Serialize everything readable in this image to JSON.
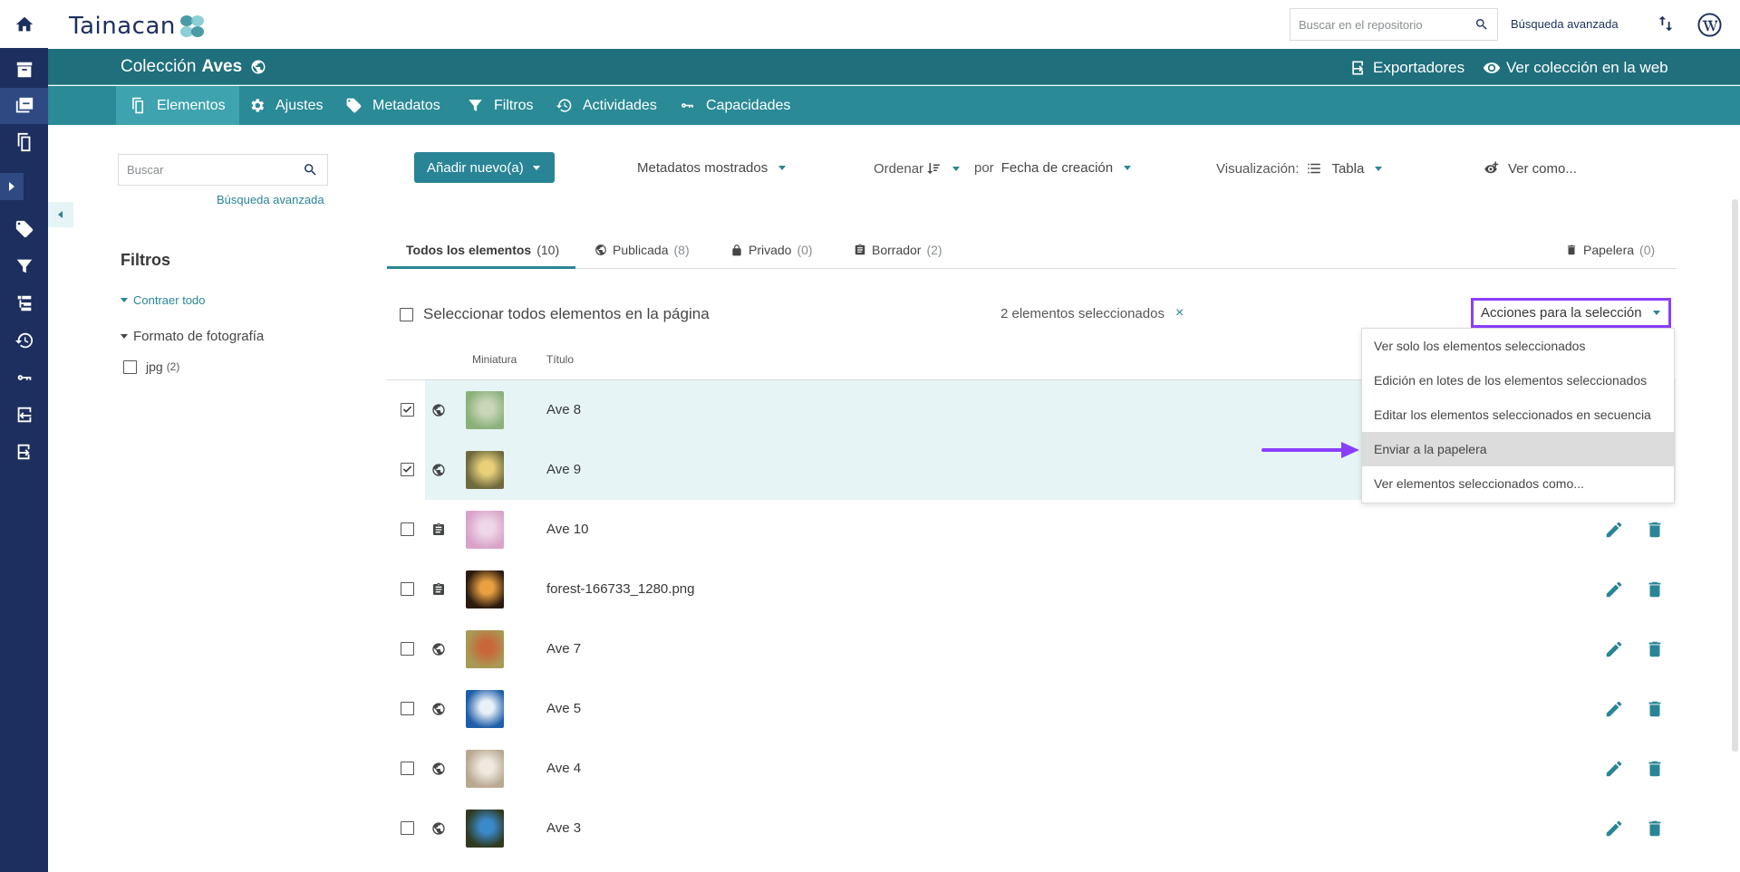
{
  "header": {
    "logo_text": "Tainacan",
    "search_placeholder": "Buscar en el repositorio",
    "advanced_search": "Búsqueda avanzada"
  },
  "collection": {
    "prefix": "Colección",
    "name": "Aves",
    "exporters": "Exportadores",
    "view_web": "Ver colección en la web"
  },
  "nav_tabs": {
    "items": "Elementos",
    "settings": "Ajustes",
    "metadata": "Metadatos",
    "filters": "Filtros",
    "activities": "Actividades",
    "capabilities": "Capacidades"
  },
  "sidebar": {
    "search_placeholder": "Buscar",
    "advanced_search": "Búsqueda avanzada",
    "filters_title": "Filtros",
    "collapse_all": "Contraer todo",
    "facet_label": "Formato de fotografía",
    "facet_option_label": "jpg",
    "facet_option_count": "(2)"
  },
  "toolbar": {
    "add_new": "Añadir nuevo(a)",
    "shown_metadata": "Metadatos mostrados",
    "sort_label": "Ordenar",
    "by_label": "por",
    "sort_field": "Fecha de creación",
    "view_label": "Visualización:",
    "view_mode": "Tabla",
    "view_as": "Ver como..."
  },
  "status_tabs": {
    "all_label": "Todos los elementos",
    "all_count": "(10)",
    "published_label": "Publicada",
    "published_count": "(8)",
    "private_label": "Privado",
    "private_count": "(0)",
    "draft_label": "Borrador",
    "draft_count": "(2)",
    "trash_label": "Papelera",
    "trash_count": "(0)"
  },
  "selection": {
    "select_all": "Seleccionar todos elementos en la página",
    "selected_count": "2 elementos seleccionados",
    "clear": "×",
    "actions_button": "Acciones para la selección"
  },
  "actions_menu": {
    "view_only_selected": "Ver solo los elementos seleccionados",
    "bulk_edit": "Edición en lotes de los elementos seleccionados",
    "sequence_edit": "Editar los elementos seleccionados en secuencia",
    "send_to_trash": "Enviar a la papelera",
    "view_selected_as": "Ver elementos seleccionados como..."
  },
  "table": {
    "col_thumbnail": "Miniatura",
    "col_title": "Título",
    "rows": [
      {
        "title": "Ave 8",
        "status": "globe-icon",
        "selected": true,
        "thumb_colors": [
          "#8bb07a",
          "#c9d6b8"
        ]
      },
      {
        "title": "Ave 9",
        "status": "globe-icon",
        "selected": true,
        "thumb_colors": [
          "#6e6a3d",
          "#e8d07a"
        ]
      },
      {
        "title": "Ave 10",
        "status": "clipboard-icon",
        "selected": false,
        "thumb_colors": [
          "#d9a3c9",
          "#eed7e8"
        ]
      },
      {
        "title": "forest-166733_1280.png",
        "status": "clipboard-icon",
        "selected": false,
        "thumb_colors": [
          "#2a1a10",
          "#e8a040"
        ]
      },
      {
        "title": "Ave 7",
        "status": "globe-icon",
        "selected": false,
        "thumb_colors": [
          "#a89a55",
          "#c8683a"
        ]
      },
      {
        "title": "Ave 5",
        "status": "globe-icon",
        "selected": false,
        "thumb_colors": [
          "#1e5fa8",
          "#e8f0f8"
        ]
      },
      {
        "title": "Ave 4",
        "status": "globe-icon",
        "selected": false,
        "thumb_colors": [
          "#b8a890",
          "#efe9e0"
        ]
      },
      {
        "title": "Ave 3",
        "status": "globe-icon",
        "selected": false,
        "thumb_colors": [
          "#2f3a20",
          "#3a8acb"
        ]
      }
    ]
  },
  "colors": {
    "rail": "#1d2f5e",
    "collection_bar": "#1f6f7c",
    "tabs_bar": "#2a8a96",
    "accent": "#298596",
    "selected_row": "#e6f4f6",
    "highlight_border": "#8a3ffc"
  }
}
